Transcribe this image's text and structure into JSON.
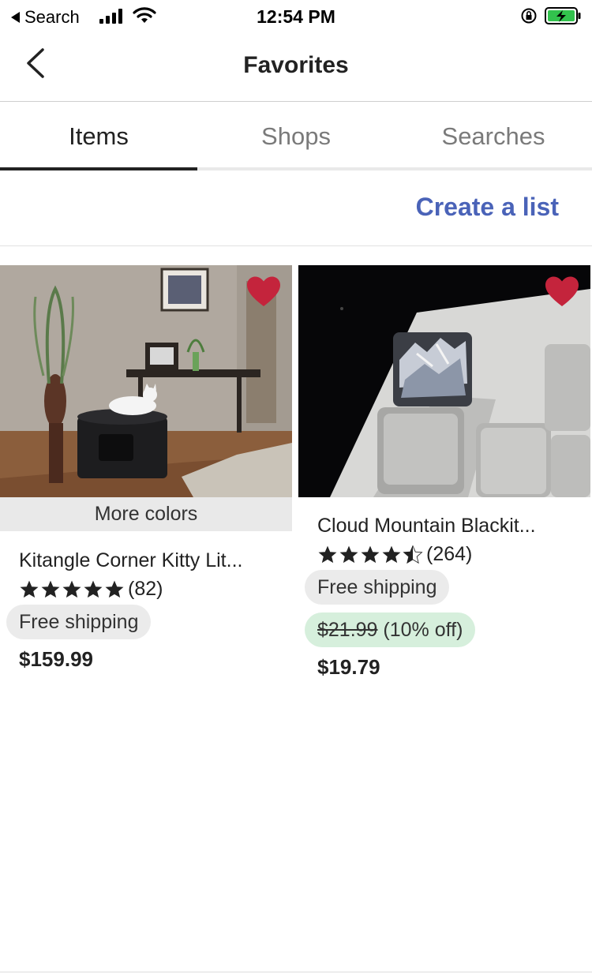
{
  "status_bar": {
    "back_label": "Search",
    "time": "12:54 PM"
  },
  "nav": {
    "title": "Favorites"
  },
  "tabs": [
    {
      "label": "Items",
      "active": true
    },
    {
      "label": "Shops",
      "active": false
    },
    {
      "label": "Searches",
      "active": false
    }
  ],
  "actions": {
    "create_list": "Create a list"
  },
  "items": [
    {
      "title": "Kitangle Corner Kitty Lit...",
      "more_colors": "More colors",
      "rating": 5,
      "review_count": "(82)",
      "shipping": "Free shipping",
      "price": "$159.99",
      "favorited": true
    },
    {
      "title": "Cloud Mountain Blackit...",
      "rating": 4.5,
      "review_count": "(264)",
      "shipping": "Free shipping",
      "original_price": "$21.99",
      "discount": "(10% off)",
      "price": "$19.79",
      "favorited": true
    }
  ],
  "colors": {
    "accent_link": "#4a63b8",
    "heart": "#c4243c",
    "sale_pill": "#d6efdc",
    "battery": "#32c24d"
  }
}
